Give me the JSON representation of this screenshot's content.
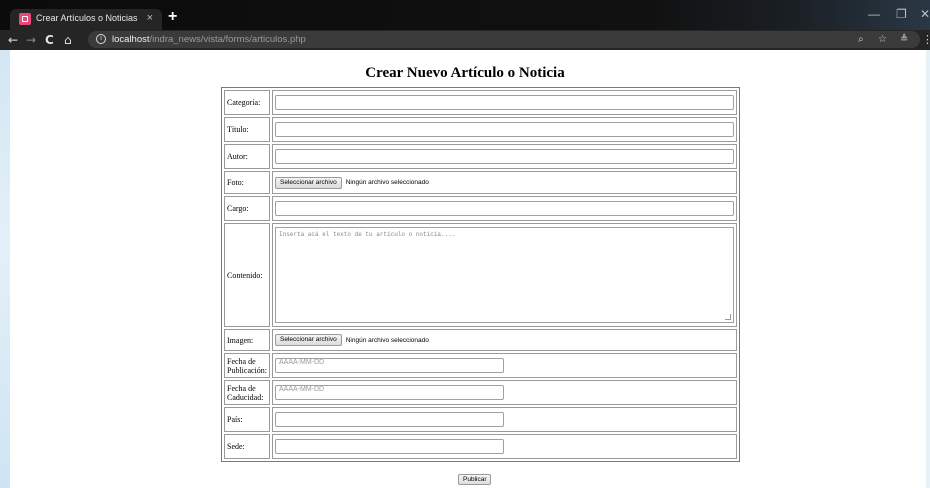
{
  "browser": {
    "tab_title": "Crear Artículos o Noticias",
    "tab_close": "×",
    "new_tab": "+",
    "url_host": "localhost",
    "url_path": "/indra_news/vista/forms/articulos.php",
    "nav": {
      "back": "←",
      "forward": "→",
      "reload": "C",
      "home": "⌂"
    },
    "omnibox_icons": {
      "zoom": "⌕",
      "star": "☆",
      "cast": "≜",
      "menu": "⋮"
    },
    "window": {
      "minimize": "—",
      "restore": "❐",
      "close": "✕"
    }
  },
  "page": {
    "title": "Crear Nuevo Artículo o Noticia",
    "fields": {
      "categoria": {
        "label": "Categoría:",
        "value": ""
      },
      "titulo": {
        "label": "Título:",
        "value": ""
      },
      "autor": {
        "label": "Autor:",
        "value": ""
      },
      "foto": {
        "label": "Foto:",
        "button": "Seleccionar archivo",
        "status": "Ningún archivo seleccionado"
      },
      "cargo": {
        "label": "Cargo:",
        "value": ""
      },
      "contenido": {
        "label": "Contenido:",
        "placeholder": "Inserta acá el texto de tu artículo o noticia...."
      },
      "imagen": {
        "label": "Imagen:",
        "button": "Seleccionar archivo",
        "status": "Ningún archivo seleccionado"
      },
      "fecha_publicacion": {
        "label": "Fecha de Publicación:",
        "placeholder": "AAAA-MM-DD"
      },
      "fecha_caducidad": {
        "label": "Fecha de Caducidad:",
        "placeholder": "AAAA-MM-DD"
      },
      "pais": {
        "label": "País:",
        "value": ""
      },
      "sede": {
        "label": "Sede:",
        "value": ""
      }
    },
    "submit_label": "Publicar"
  }
}
